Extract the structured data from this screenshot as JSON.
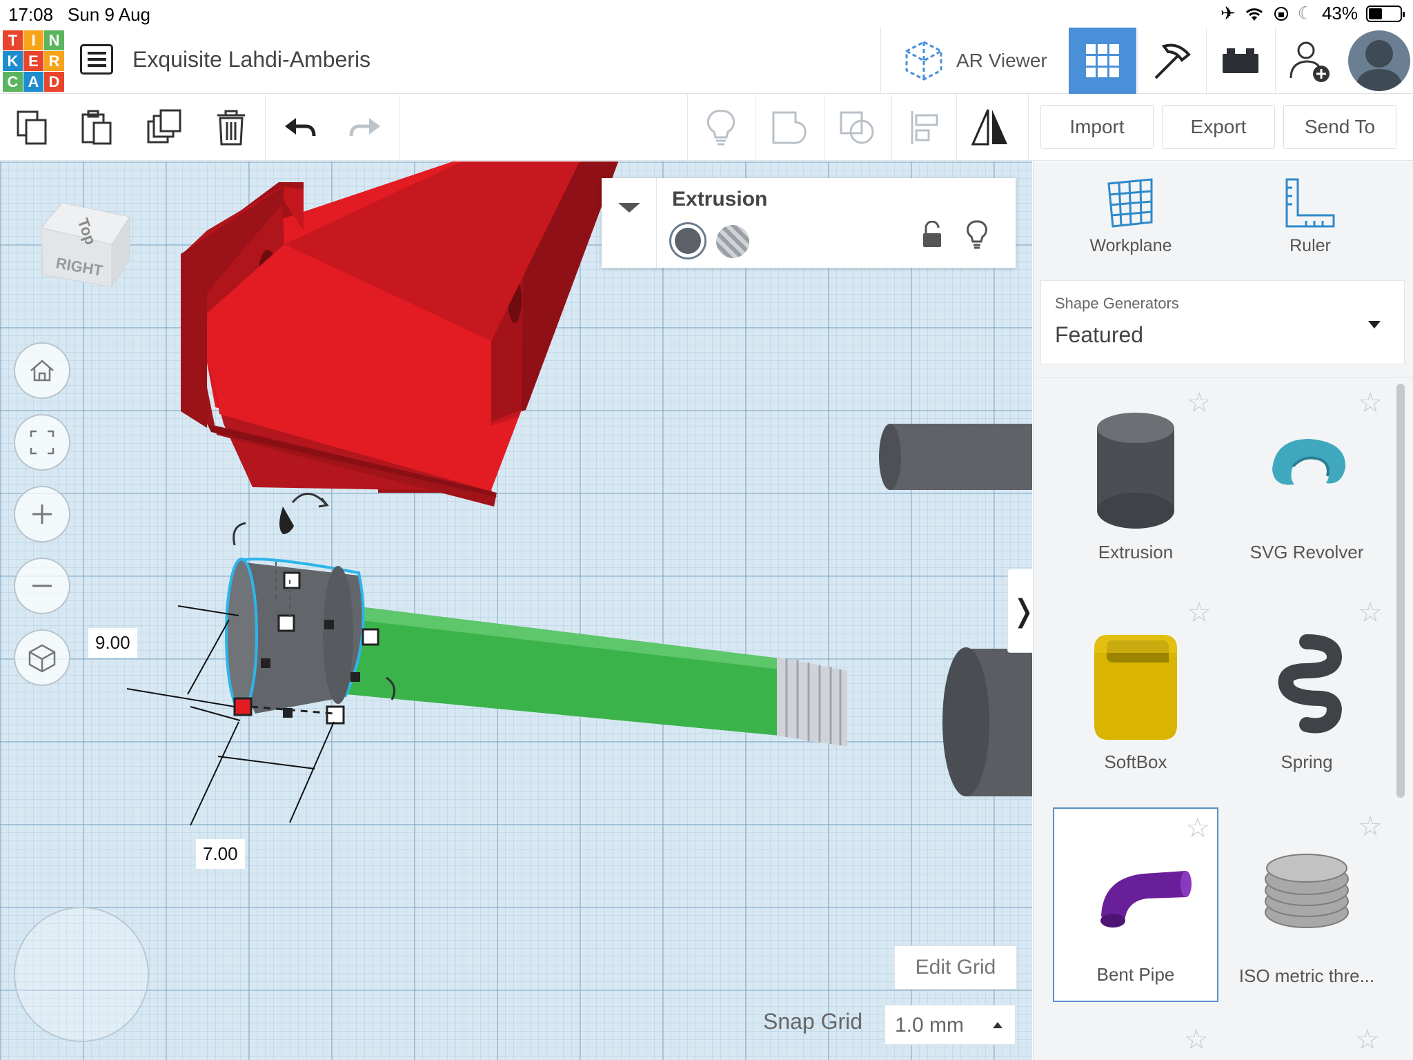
{
  "status_bar": {
    "time": "17:08",
    "date": "Sun 9 Aug",
    "battery": "43%",
    "battery_level": 0.43
  },
  "header": {
    "logo_letters": [
      "T",
      "I",
      "N",
      "K",
      "E",
      "R",
      "C",
      "A",
      "D"
    ],
    "logo_colors": [
      "#e8452c",
      "#f7a41c",
      "#5ab55e",
      "#1d8dcf",
      "#e8452c",
      "#f7a41c",
      "#5ab55e",
      "#1d8dcf",
      "#e8452c"
    ],
    "design_title": "Exquisite Lahdi-Amberis",
    "ar_viewer_label": "AR Viewer",
    "buttons": [
      {
        "name": "3d-design-view",
        "icon": "grid-icon",
        "active": true
      },
      {
        "name": "codeblocks-view",
        "icon": "pickaxe-icon",
        "active": false
      },
      {
        "name": "bricks-view",
        "icon": "brick-icon",
        "active": false
      },
      {
        "name": "add-user",
        "icon": "add-user-icon",
        "active": false
      }
    ],
    "accent_color": "#4a90d9"
  },
  "toolbar": {
    "left_tools": [
      "copy-icon",
      "paste-icon",
      "duplicate-icon",
      "delete-icon",
      "undo-icon",
      "redo-icon"
    ],
    "right_tools": [
      "lightbulb-icon",
      "group-icon",
      "ungroup-icon",
      "align-icon",
      "mirror-icon"
    ],
    "import_label": "Import",
    "export_label": "Export",
    "send_to_label": "Send To"
  },
  "workplane": {
    "view_cube": {
      "top_label": "Top",
      "front_label": "RIGHT"
    },
    "dimensions": {
      "height": "9.00",
      "width": "7.00"
    },
    "edit_grid_label": "Edit Grid",
    "snap_grid_label": "Snap Grid",
    "snap_grid_value": "1.0 mm",
    "shape_colors": {
      "red": "#e31b23",
      "green": "#3ab34a",
      "grey": "#5f6368"
    }
  },
  "inspector": {
    "title": "Extrusion",
    "solid_color": "#5b6167"
  },
  "panel": {
    "workplane_label": "Workplane",
    "ruler_label": "Ruler",
    "generators_caption": "Shape Generators",
    "generators_value": "Featured",
    "shapes": [
      {
        "label": "Extrusion",
        "color": "#4b4f54"
      },
      {
        "label": "SVG Revolver",
        "color": "#3fa8bf"
      },
      {
        "label": "SoftBox",
        "color": "#d9b400"
      },
      {
        "label": "Spring",
        "color": "#3f4347"
      },
      {
        "label": "Bent Pipe",
        "color": "#6a1f9a",
        "selected": true
      },
      {
        "label": "ISO metric thre...",
        "color": "#a8a8a8"
      }
    ]
  }
}
